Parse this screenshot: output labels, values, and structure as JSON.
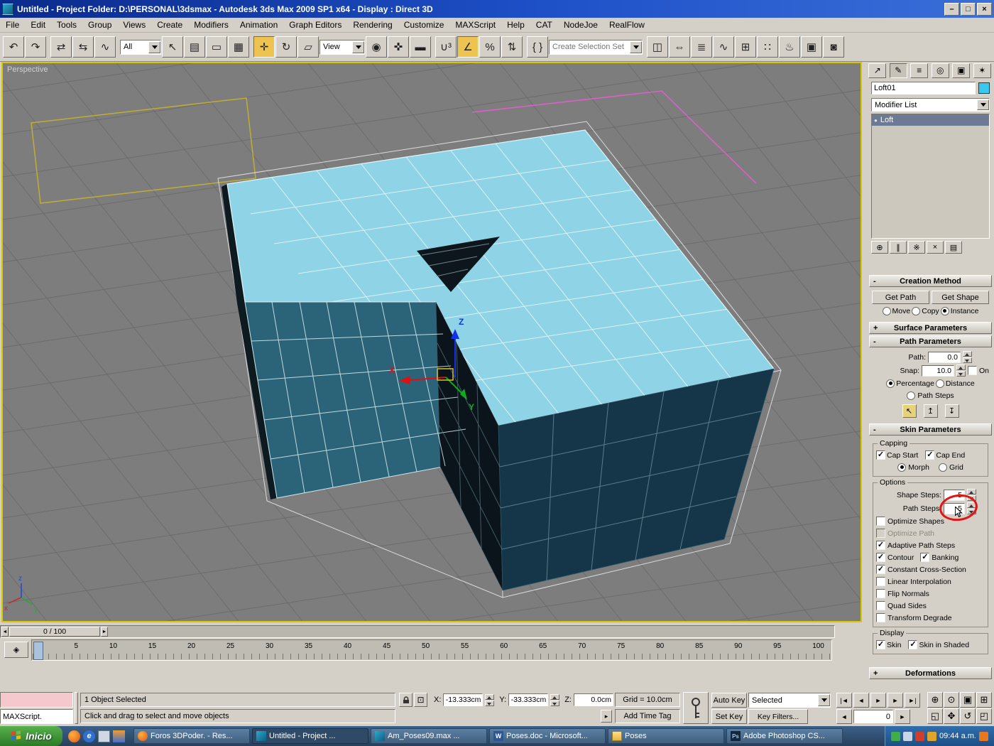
{
  "window": {
    "title": "Untitled    - Project Folder: D:\\PERSONAL\\3dsmax    - Autodesk 3ds Max  2009 SP1  x64    - Display : Direct 3D",
    "min": "–",
    "max": "□",
    "close": "×"
  },
  "menu": {
    "items": [
      "File",
      "Edit",
      "Tools",
      "Group",
      "Views",
      "Create",
      "Modifiers",
      "Animation",
      "Graph Editors",
      "Rendering",
      "Customize",
      "MAXScript",
      "Help",
      "CAT",
      "NodeJoe",
      "RealFlow"
    ]
  },
  "toolbar": {
    "filter_value": "All",
    "coord_value": "View",
    "selection_set": "Create Selection Set"
  },
  "viewport": {
    "label": "Perspective",
    "axis_x": "X",
    "axis_y": "Y",
    "axis_z": "Z",
    "tripod_x": "x",
    "tripod_y": "y",
    "tripod_z": "z"
  },
  "cmd": {
    "object_name": "Loft01",
    "modifier_list": "Modifier List",
    "stack": [
      "Loft"
    ],
    "creation": {
      "collapse": "-",
      "title": "Creation Method",
      "get_path": "Get Path",
      "get_shape": "Get Shape",
      "move": "Move",
      "copy": "Copy",
      "instance": "Instance",
      "move_on": false,
      "copy_on": false,
      "instance_on": true
    },
    "surface": {
      "collapse": "+",
      "title": "Surface Parameters"
    },
    "path": {
      "collapse": "-",
      "title": "Path Parameters",
      "path_label": "Path:",
      "path_value": "0.0",
      "snap_label": "Snap:",
      "snap_value": "10.0",
      "on_label": "On",
      "on_checked": false,
      "percentage": "Percentage",
      "percentage_on": true,
      "distance": "Distance",
      "distance_on": false,
      "path_steps": "Path Steps",
      "path_steps_on": false
    },
    "skin": {
      "collapse": "-",
      "title": "Skin Parameters",
      "capping": {
        "title": "Capping",
        "cap_start": "Cap Start",
        "cap_start_on": true,
        "cap_end": "Cap End",
        "cap_end_on": true,
        "morph": "Morph",
        "morph_on": true,
        "grid": "Grid",
        "grid_on": false
      },
      "options": {
        "title": "Options",
        "shape_steps_label": "Shape Steps:",
        "shape_steps_value": "5",
        "path_steps_label": "Path Steps:",
        "path_steps_value": "5",
        "optimize_shapes": "Optimize Shapes",
        "optimize_shapes_on": false,
        "optimize_path": "Optimize Path",
        "optimize_path_on": false,
        "adaptive": "Adaptive Path Steps",
        "adaptive_on": true,
        "contour": "Contour",
        "contour_on": true,
        "banking": "Banking",
        "banking_on": true,
        "constant": "Constant Cross-Section",
        "constant_on": true,
        "linear": "Linear Interpolation",
        "linear_on": false,
        "flip": "Flip Normals",
        "flip_on": false,
        "quad": "Quad Sides",
        "quad_on": false,
        "degrade": "Transform Degrade",
        "degrade_on": false
      },
      "display": {
        "title": "Display",
        "skin": "Skin",
        "skin_on": true,
        "shaded": "Skin in Shaded",
        "shaded_on": true
      }
    },
    "deformations": {
      "collapse": "+",
      "title": "Deformations"
    }
  },
  "timeline": {
    "slider": "0 / 100",
    "ticks": [
      "0",
      "5",
      "10",
      "15",
      "20",
      "25",
      "30",
      "35",
      "40",
      "45",
      "50",
      "55",
      "60",
      "65",
      "70",
      "75",
      "80",
      "85",
      "90",
      "95",
      "100"
    ]
  },
  "status": {
    "selection": "1 Object Selected",
    "prompt": "Click and drag to select and move objects",
    "x": "X:",
    "xv": "-13.333cm",
    "y": "Y:",
    "yv": "-33.333cm",
    "z": "Z:",
    "zv": "0.0cm",
    "grid": "Grid = 10.0cm",
    "time_tag": "Add Time Tag",
    "listener": "MAXScript."
  },
  "anim": {
    "auto_key": "Auto Key",
    "set_key": "Set Key",
    "selected": "Selected",
    "key_filters": "Key Filters...",
    "frame": "0"
  },
  "taskbar": {
    "start": "Inicio",
    "clock": "09:44 a.m.",
    "tasks": [
      "Foros 3DPoder. - Res...",
      "Untitled    - Project ...",
      "Am_Poses09.max    ...",
      "Poses.doc - Microsoft...",
      "Poses",
      "Adobe Photoshop CS..."
    ]
  },
  "icons": {
    "tb": {
      "undo": "↶",
      "redo": "↷",
      "link": "⇄",
      "unlink": "⇆",
      "bind": "∿",
      "sel": "↖",
      "selname": "▤",
      "region": "▭",
      "crossing": "▦",
      "move": "✛",
      "rotate": "↻",
      "scale": "▱",
      "center": "◉",
      "manip": "✜",
      "kbd": "▬",
      "snap3": "∪³",
      "angle": "∠",
      "percent": "%",
      "spin": "⇅",
      "sets": "{ }",
      "mirror": "◫",
      "align": "⇔",
      "layers": "≣",
      "curve": "∿",
      "schem": "⊞",
      "mat": "∷",
      "rset": "♨",
      "rframe": "▣",
      "qrender": "◙"
    },
    "tabs": {
      "create": "↗",
      "modify": "✎",
      "hier": "≡",
      "motion": "◎",
      "display": "▣",
      "util": "✶"
    },
    "stack": {
      "pin": "⊕",
      "endres": "∥",
      "unique": "※",
      "remove": "×",
      "config": "▤",
      "bulb": "●"
    },
    "path": {
      "pick": "↖",
      "up": "↥",
      "down": "↧"
    },
    "time": {
      "start": "|◄",
      "prevk": "◄",
      "play": "►",
      "nextk": "►",
      "end": "►|",
      "prevf": "◄",
      "nextf": "►"
    },
    "nav": {
      "zoom": "⊕",
      "zoomall": "⊙",
      "ext": "▣",
      "extall": "⊞",
      "reg": "◱",
      "pan": "✥",
      "orbit": "↺",
      "max": "◰"
    },
    "misc": {
      "trackbar": "◈",
      "timetag": "▸",
      "tsleft": "◄",
      "tsright": "►"
    },
    "task": {
      "word": "W",
      "ps": "Ps",
      "ie": "e"
    }
  }
}
